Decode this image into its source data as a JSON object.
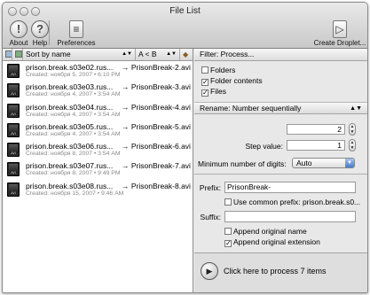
{
  "window": {
    "title": "File List"
  },
  "toolbar": {
    "about_label": "About",
    "help_label": "Help",
    "preferences_label": "Preferences",
    "create_droplet_label": "Create Droplet...",
    "about_icon": "!",
    "help_icon": "?"
  },
  "list": {
    "sort_label": "Sort by name",
    "order_label": "A < B",
    "files": [
      {
        "name": "prison.break.s03e02.rus...",
        "target": "→ PrisonBreak-2.avi",
        "created": "Created: ноября 5, 2007 • 6:10 PM"
      },
      {
        "name": "prison.break.s03e03.rus...",
        "target": "→ PrisonBreak-3.avi",
        "created": "Created: ноября 4, 2007 • 3:54 AM"
      },
      {
        "name": "prison.break.s03e04.rus...",
        "target": "→ PrisonBreak-4.avi",
        "created": "Created: ноября 4, 2007 • 3:54 AM"
      },
      {
        "name": "prison.break.s03e05.rus...",
        "target": "→ PrisonBreak-5.avi",
        "created": "Created: ноября 4, 2007 • 3:54 AM"
      },
      {
        "name": "prison.break.s03e06.rus...",
        "target": "→ PrisonBreak-6.avi",
        "created": "Created: ноября 8, 2007 • 3:54 AM"
      },
      {
        "name": "prison.break.s03e07.rus...",
        "target": "→ PrisonBreak-7.avi",
        "created": "Created: ноября 8, 2007 • 9:49 PM"
      },
      {
        "name": "prison.break.s03e08.rus...",
        "target": "→ PrisonBreak-8.avi",
        "created": "Created: ноября 15, 2007 • 9:46 AM"
      }
    ],
    "file_badge": "AVI"
  },
  "filter": {
    "title": "Filter: Process...",
    "folders_label": "Folders",
    "folder_contents_label": "Folder contents",
    "files_label": "Files",
    "folders_checked": false,
    "folder_contents_checked": true,
    "files_checked": true
  },
  "rename": {
    "title": "Rename: Number sequentially",
    "first_number_label": "First number:",
    "first_number_value": "2",
    "step_value_label": "Step value:",
    "step_value_value": "1",
    "min_digits_label": "Minimum number of digits:",
    "min_digits_value": "Auto",
    "prefix_label": "Prefix:",
    "prefix_value": "PrisonBreak-",
    "use_common_prefix_label": "Use common prefix: prison.break.s0...",
    "use_common_prefix_checked": false,
    "suffix_label": "Suffix:",
    "suffix_value": "",
    "append_original_name_label": "Append original name",
    "append_original_name_checked": false,
    "append_original_extension_label": "Append original extension",
    "append_original_extension_checked": true
  },
  "process": {
    "label": "Click here to process 7 items"
  }
}
